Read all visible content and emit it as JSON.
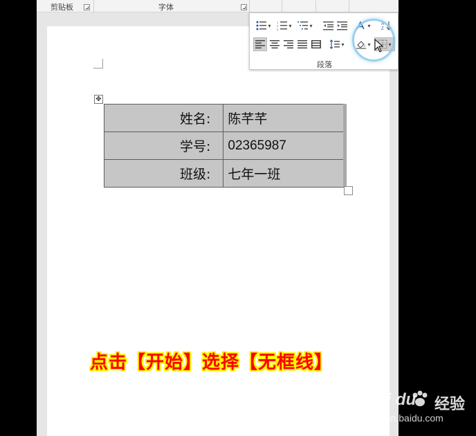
{
  "ribbon": {
    "clipboard_label": "剪贴板",
    "font_label": "字体",
    "paragraph_label": "段落"
  },
  "table": {
    "rows": [
      {
        "label": "姓名:",
        "value": "陈芊芊"
      },
      {
        "label": "学号:",
        "value": "02365987"
      },
      {
        "label": "班级:",
        "value": "七年一班"
      }
    ],
    "shading_color": "#c6c6c6"
  },
  "caption": "点击【开始】选择【无框线】",
  "caption_colors": {
    "text": "#ff0000",
    "outline": "#fff200"
  },
  "watermark": {
    "logo": "Bai du",
    "brand": "经验",
    "url": "jingyan.baidu.com"
  },
  "icons": [
    "bullets-icon",
    "numbering-icon",
    "multilevel-list-icon",
    "decrease-indent-icon",
    "increase-indent-icon",
    "chinese-layout-icon",
    "sort-icon",
    "align-left-icon",
    "align-center-icon",
    "align-right-icon",
    "justify-icon",
    "distributed-icon",
    "line-spacing-icon",
    "shading-icon",
    "borders-icon"
  ]
}
